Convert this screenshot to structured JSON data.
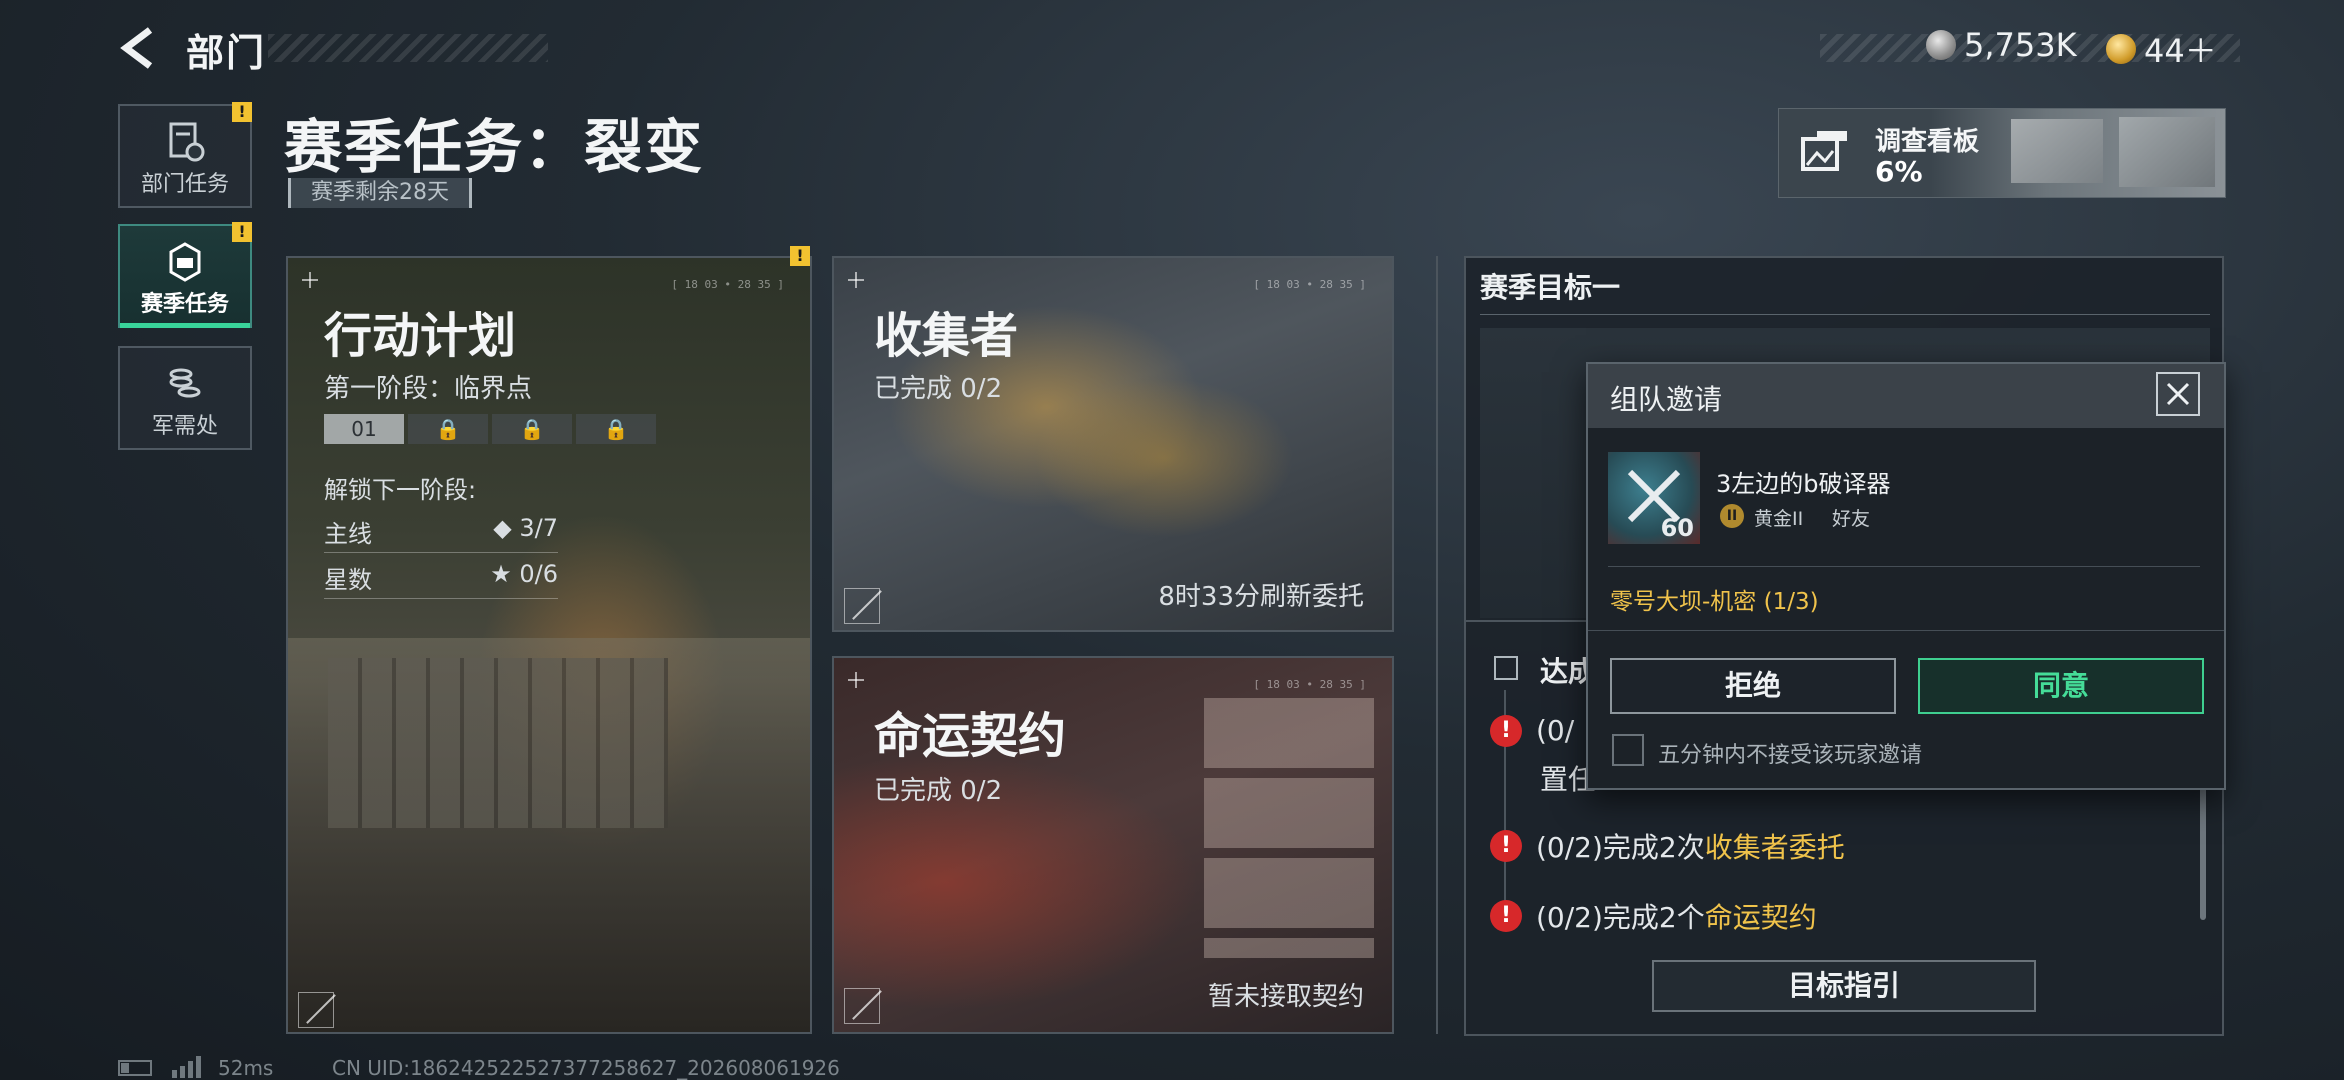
{
  "header": {
    "title": "部门"
  },
  "currency": [
    {
      "icon": "silver-coin-icon",
      "value": "5,753K"
    },
    {
      "icon": "gold-token-icon",
      "value": "44＋"
    }
  ],
  "nav": [
    {
      "label": "部门任务",
      "icon": "document-icon",
      "badge": "!"
    },
    {
      "label": "赛季任务",
      "icon": "season-emblem-icon",
      "badge": "!"
    },
    {
      "label": "军需处",
      "icon": "coin-stack-icon"
    }
  ],
  "page": {
    "title": "赛季任务：裂变",
    "season_remaining": "赛季剩余28天"
  },
  "survey": {
    "label": "调查看板",
    "percent": "6%"
  },
  "cards": {
    "action": {
      "title": "行动计划",
      "stage": "第一阶段：临界点",
      "stage_chips": [
        "01",
        "🔒",
        "🔒",
        "🔒"
      ],
      "unlock_label": "解锁下一阶段:",
      "rows": [
        {
          "label": "主线",
          "value": "◆ 3/7"
        },
        {
          "label": "星数",
          "value": "★ 0/6"
        }
      ],
      "hud": "[ 18 03 • 28 35 ]",
      "badge": "!"
    },
    "collector": {
      "title": "收集者",
      "status": "已完成 0/2",
      "footer": "8时33分刷新委托",
      "hud": "[ 18 03 • 28 35 ]"
    },
    "fate": {
      "title": "命运契约",
      "status": "已完成 0/2",
      "footer": "暂未接取契约",
      "hud": "[ 18 03 • 28 35 ]"
    }
  },
  "goal_panel": {
    "title": "赛季目标一",
    "section_label": "达成",
    "rows": [
      {
        "text_pre": "(0/",
        "text_line2": "置任",
        "hl": ""
      },
      {
        "text_pre": "(0/2)完成2次",
        "hl": "收集者委托"
      },
      {
        "text_pre": "(0/2)完成2个",
        "hl": "命运契约"
      }
    ],
    "guide_button": "目标指引"
  },
  "dialog": {
    "title": "组队邀请",
    "player_name": "3左边的b破译器",
    "player_level": "60",
    "rank": "黄金II",
    "relation": "好友",
    "mission": "零号大坝-机密 (1/3)",
    "reject": "拒绝",
    "accept": "同意",
    "mute_label": "五分钟内不接受该玩家邀请"
  },
  "status_bar": {
    "ping": "52ms",
    "uid": "CN UID:1862425225273772586​27_202608061926"
  }
}
